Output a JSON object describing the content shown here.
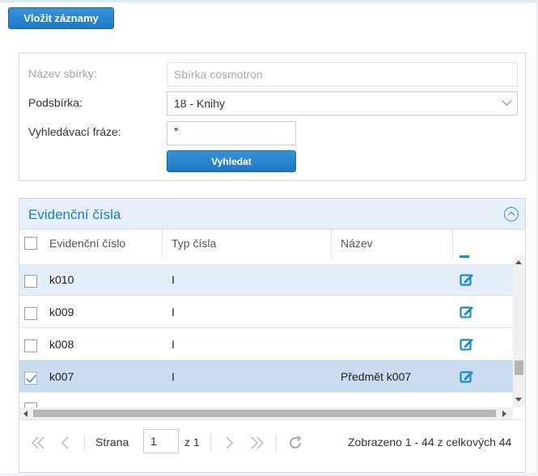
{
  "toolbar": {
    "insert_label": "Vložit záznamy"
  },
  "form": {
    "collection_label": "Název sbírky:",
    "collection_value": "Sbírka cosmotron",
    "subcollection_label": "Podsbírka:",
    "subcollection_value": "18 - Knihy",
    "phrase_label": "Vyhledávací fráze:",
    "phrase_value": "*",
    "search_label": "Vyhledat"
  },
  "grid": {
    "title": "Evidenční čísla",
    "columns": [
      "Evidenční číslo",
      "Typ čísla",
      "Název"
    ],
    "rows": [
      {
        "number": "k010",
        "type": "I",
        "name": "",
        "checked": false
      },
      {
        "number": "k009",
        "type": "I",
        "name": "",
        "checked": false
      },
      {
        "number": "k008",
        "type": "I",
        "name": "",
        "checked": false
      },
      {
        "number": "k007",
        "type": "I",
        "name": "Předmět k007",
        "checked": true
      }
    ],
    "icons": {
      "edit": "edit-icon",
      "collapse": "chevron-up-icon"
    }
  },
  "pager": {
    "page_label": "Strana",
    "page_value": "1",
    "of_label": "z 1",
    "summary": "Zobrazeno 1 - 44 z celkových 44"
  },
  "colors": {
    "accent": "#1f78c4",
    "title_blue": "#1b7fc4",
    "row_alt": "#e4eef8",
    "row_selected": "#c9dcf0",
    "edit_icon": "#1a8ec0"
  }
}
